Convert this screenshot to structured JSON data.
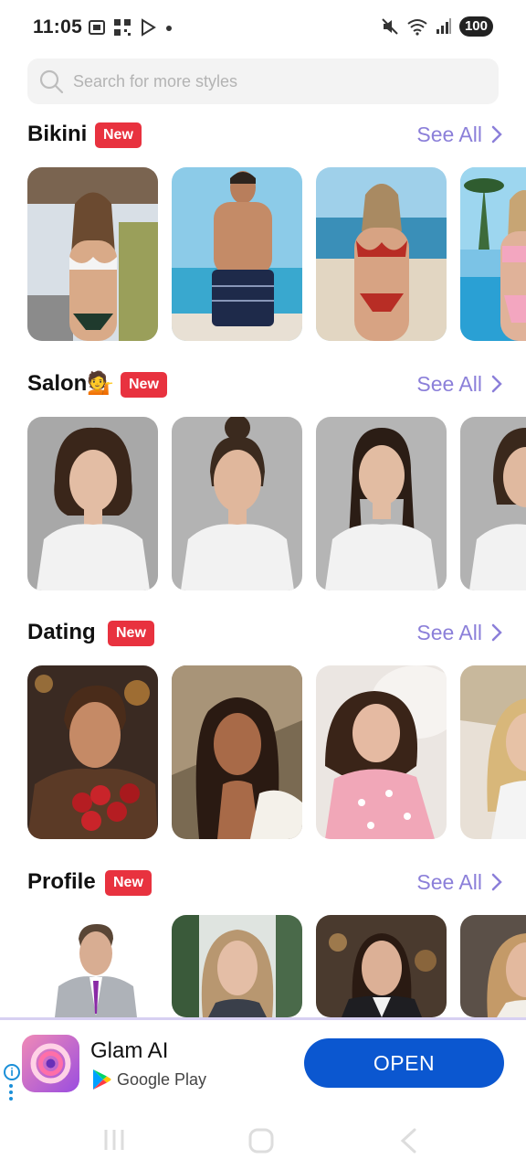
{
  "status_bar": {
    "time": "11:05",
    "battery": "100",
    "left_icons": [
      "screenshot-icon",
      "qr-icon",
      "play-icon",
      "dot-icon"
    ],
    "right_icons": [
      "mute-icon",
      "wifi-icon",
      "signal-icon"
    ]
  },
  "search": {
    "placeholder": "Search for more styles"
  },
  "sections": [
    {
      "title": "Bikini",
      "badge": "New",
      "see_all": "See All"
    },
    {
      "title": "Salon💁",
      "badge": "New",
      "see_all": "See All"
    },
    {
      "title": "Dating",
      "badge": "New",
      "see_all": "See All"
    },
    {
      "title": "Profile",
      "badge": "New",
      "see_all": "See All"
    }
  ],
  "ad": {
    "app_name": "Glam AI",
    "store": "Google Play",
    "cta": "OPEN",
    "info": "i"
  },
  "colors": {
    "accent": "#8b7fd9",
    "badge": "#e8323f",
    "cta": "#0b57d0"
  }
}
